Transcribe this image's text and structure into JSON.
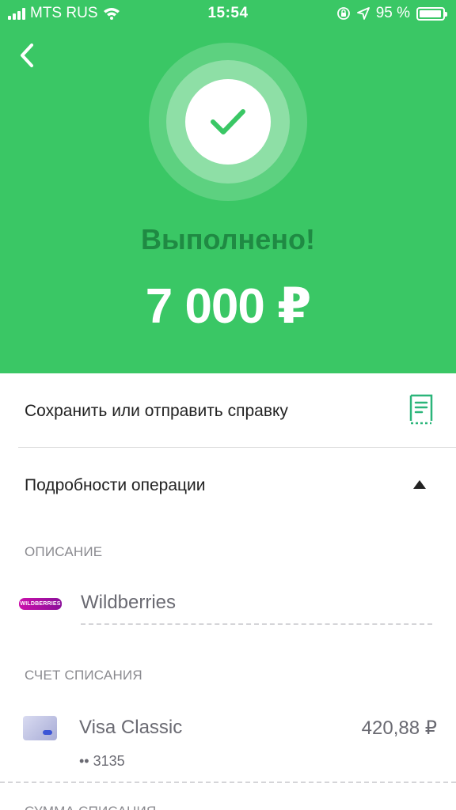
{
  "status": {
    "carrier": "MTS RUS",
    "time": "15:54",
    "battery": "95 %",
    "battery_level": 0.95
  },
  "header": {
    "title": "Выполнено!",
    "amount": "7 000 ₽",
    "color": "#3ac765"
  },
  "actions": {
    "save_label": "Сохранить или отправить справку"
  },
  "details": {
    "label": "Подробности операции"
  },
  "description": {
    "section": "ОПИСАНИЕ",
    "logo_text": "WILDBERRIES",
    "merchant": "Wildberries"
  },
  "account": {
    "section": "СЧЕТ СПИСАНИЯ",
    "card_name": "Visa Classic",
    "balance": "420,88 ₽",
    "card_number": "•• 3135"
  },
  "next_section": {
    "section": "СУММА СПИСАНИЯ"
  },
  "icons": [
    "wifi-icon",
    "rotation-lock-icon",
    "location-icon",
    "battery-icon",
    "back-icon",
    "checkmark-icon",
    "receipt-icon",
    "collapse-icon",
    "card-icon"
  ]
}
